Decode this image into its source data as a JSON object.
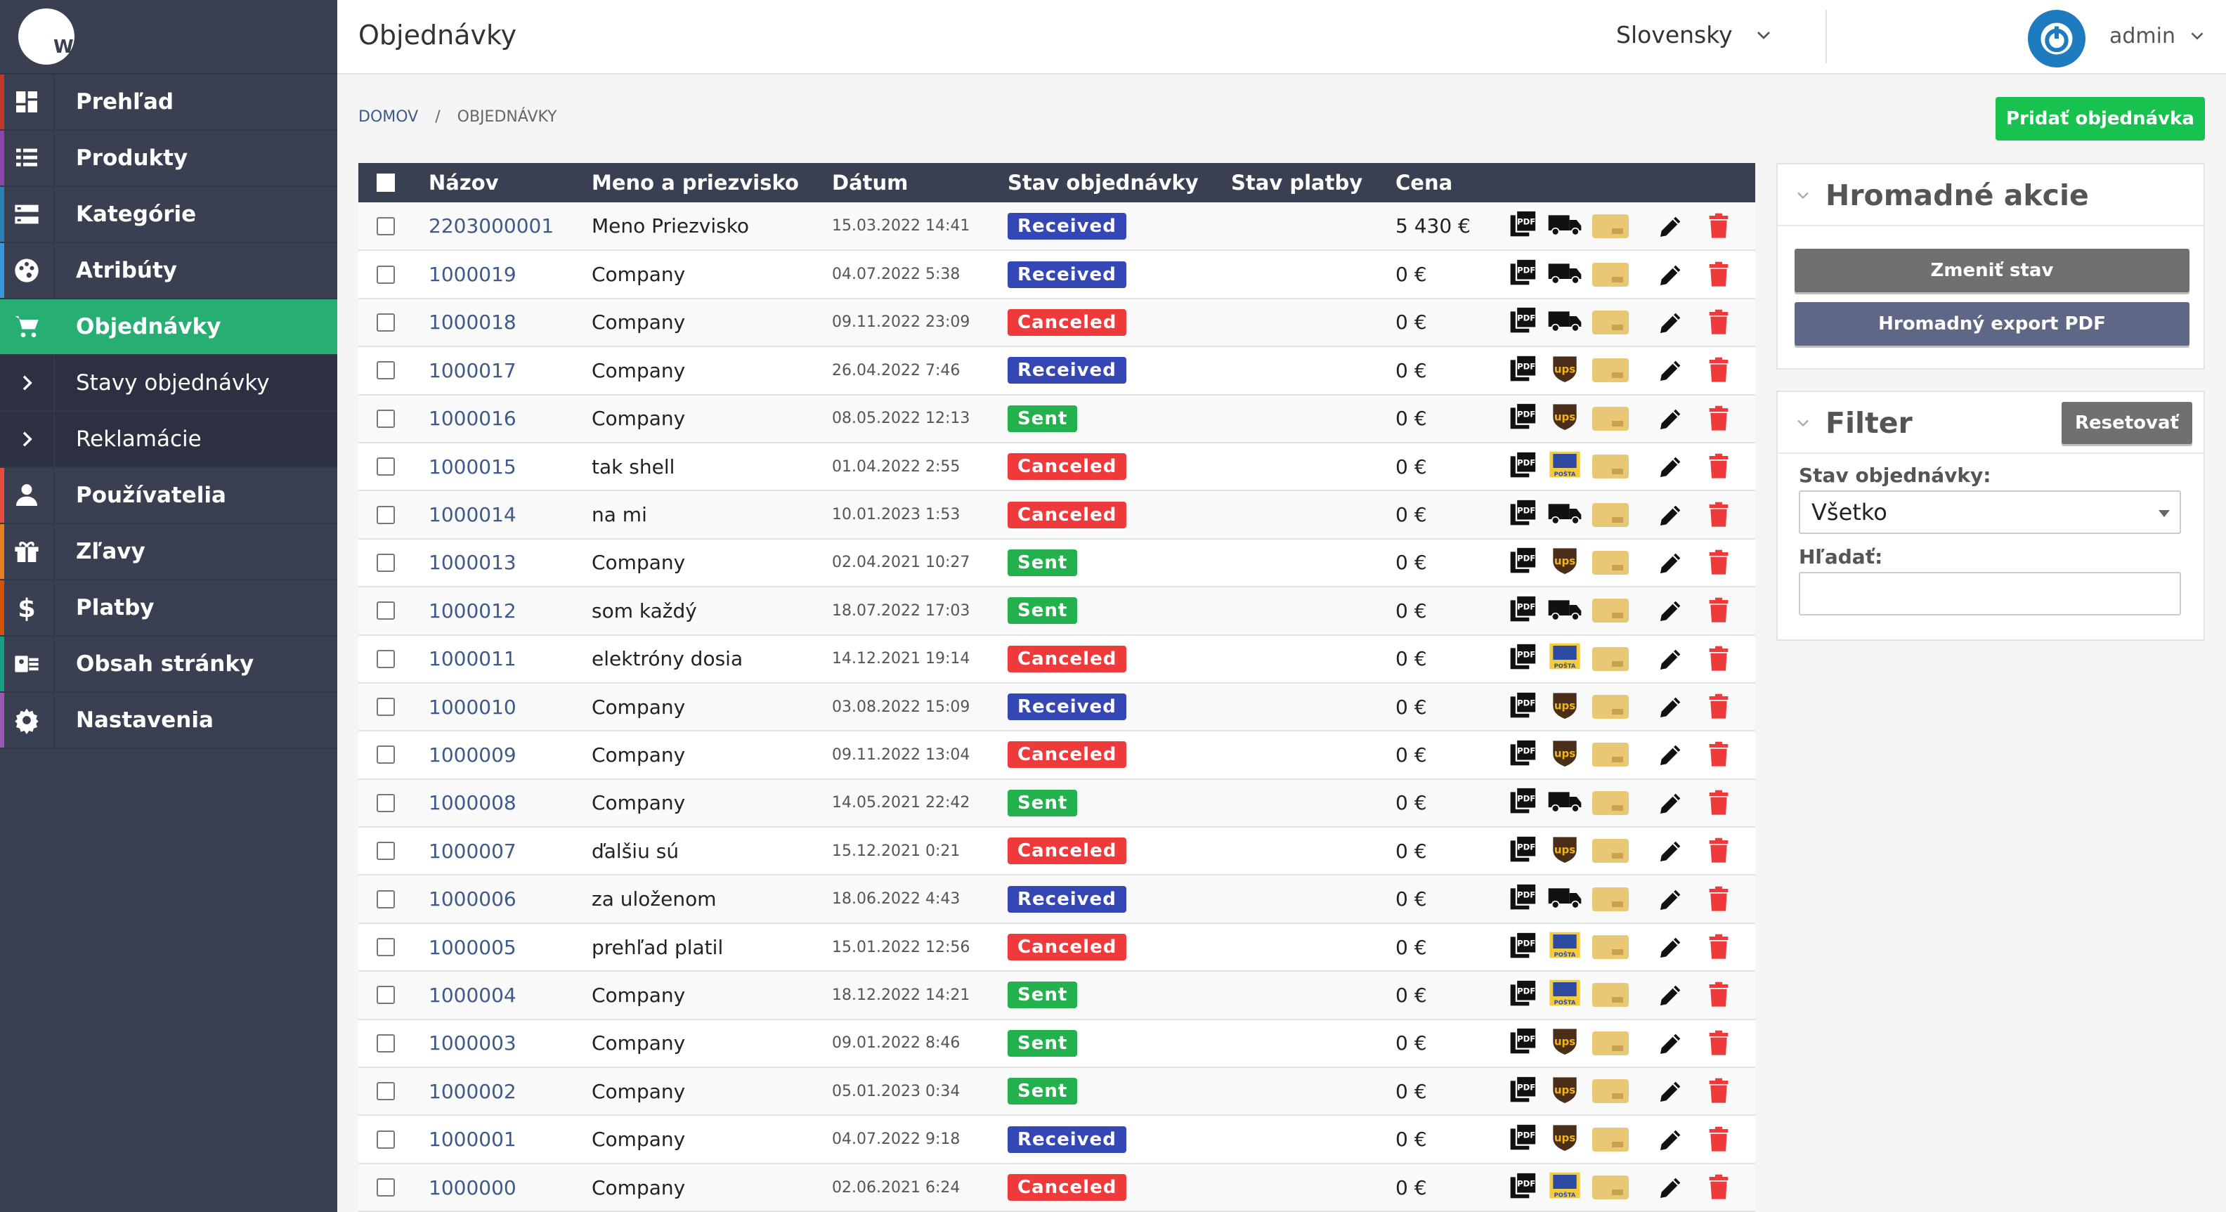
{
  "app": {
    "logo_text": "WISDOM",
    "page_title": "Objednávky"
  },
  "header": {
    "language": "Slovensky",
    "user": "admin"
  },
  "sidebar": {
    "items": [
      {
        "label": "Prehľad",
        "icon": "dashboard-icon",
        "stripe": "#c0392b"
      },
      {
        "label": "Produkty",
        "icon": "list-icon",
        "stripe": "#8e44ad"
      },
      {
        "label": "Kategórie",
        "icon": "storage-icon",
        "stripe": "#2980b9"
      },
      {
        "label": "Atribúty",
        "icon": "palette-icon",
        "stripe": "#3498db"
      },
      {
        "label": "Objednávky",
        "icon": "cart-icon",
        "stripe": "#27ae73",
        "active": true
      },
      {
        "label": "Stavy objednávky",
        "icon": "chevron-right-icon",
        "sub": true
      },
      {
        "label": "Reklamácie",
        "icon": "chevron-right-icon",
        "sub": true
      },
      {
        "label": "Používatelia",
        "icon": "person-icon",
        "stripe": "#e74c3c"
      },
      {
        "label": "Zľavy",
        "icon": "gift-icon",
        "stripe": "#e67e22"
      },
      {
        "label": "Platby",
        "icon": "dollar-icon",
        "stripe": "#d35400"
      },
      {
        "label": "Obsah stránky",
        "icon": "content-icon",
        "stripe": "#16a085"
      },
      {
        "label": "Nastavenia",
        "icon": "gear-icon",
        "stripe": "#9b59b6"
      }
    ]
  },
  "breadcrumb": {
    "home": "DOMOV",
    "sep": "/",
    "current": "OBJEDNÁVKY"
  },
  "toolbar": {
    "add_order": "Pridať objednávka"
  },
  "table": {
    "headers": {
      "name": "Názov",
      "person": "Meno a priezvisko",
      "date": "Dátum",
      "order_status": "Stav objednávky",
      "payment_status": "Stav platby",
      "price": "Cena"
    },
    "rows": [
      {
        "id": "2203000001",
        "name": "Meno Priezvisko",
        "date": "15.03.2022 14:41",
        "status": "Received",
        "price": "5 430 €",
        "ship": "truck"
      },
      {
        "id": "1000019",
        "name": "Company",
        "date": "04.07.2022 5:38",
        "status": "Received",
        "price": "0 €",
        "ship": "truck"
      },
      {
        "id": "1000018",
        "name": "Company",
        "date": "09.11.2022 23:09",
        "status": "Canceled",
        "price": "0 €",
        "ship": "truck"
      },
      {
        "id": "1000017",
        "name": "Company",
        "date": "26.04.2022 7:46",
        "status": "Received",
        "price": "0 €",
        "ship": "ups"
      },
      {
        "id": "1000016",
        "name": "Company",
        "date": "08.05.2022 12:13",
        "status": "Sent",
        "price": "0 €",
        "ship": "ups"
      },
      {
        "id": "1000015",
        "name": "tak shell",
        "date": "01.04.2022 2:55",
        "status": "Canceled",
        "price": "0 €",
        "ship": "posta"
      },
      {
        "id": "1000014",
        "name": "na mi",
        "date": "10.01.2023 1:53",
        "status": "Canceled",
        "price": "0 €",
        "ship": "truck"
      },
      {
        "id": "1000013",
        "name": "Company",
        "date": "02.04.2021 10:27",
        "status": "Sent",
        "price": "0 €",
        "ship": "ups"
      },
      {
        "id": "1000012",
        "name": "som každý",
        "date": "18.07.2022 17:03",
        "status": "Sent",
        "price": "0 €",
        "ship": "truck"
      },
      {
        "id": "1000011",
        "name": "elektróny dosia",
        "date": "14.12.2021 19:14",
        "status": "Canceled",
        "price": "0 €",
        "ship": "posta"
      },
      {
        "id": "1000010",
        "name": "Company",
        "date": "03.08.2022 15:09",
        "status": "Received",
        "price": "0 €",
        "ship": "ups"
      },
      {
        "id": "1000009",
        "name": "Company",
        "date": "09.11.2022 13:04",
        "status": "Canceled",
        "price": "0 €",
        "ship": "ups"
      },
      {
        "id": "1000008",
        "name": "Company",
        "date": "14.05.2021 22:42",
        "status": "Sent",
        "price": "0 €",
        "ship": "truck"
      },
      {
        "id": "1000007",
        "name": "ďalšiu sú",
        "date": "15.12.2021 0:21",
        "status": "Canceled",
        "price": "0 €",
        "ship": "ups"
      },
      {
        "id": "1000006",
        "name": "za uloženom",
        "date": "18.06.2022 4:43",
        "status": "Received",
        "price": "0 €",
        "ship": "truck"
      },
      {
        "id": "1000005",
        "name": "prehľad platil",
        "date": "15.01.2022 12:56",
        "status": "Canceled",
        "price": "0 €",
        "ship": "posta"
      },
      {
        "id": "1000004",
        "name": "Company",
        "date": "18.12.2022 14:21",
        "status": "Sent",
        "price": "0 €",
        "ship": "posta"
      },
      {
        "id": "1000003",
        "name": "Company",
        "date": "09.01.2022 8:46",
        "status": "Sent",
        "price": "0 €",
        "ship": "ups"
      },
      {
        "id": "1000002",
        "name": "Company",
        "date": "05.01.2023 0:34",
        "status": "Sent",
        "price": "0 €",
        "ship": "ups"
      },
      {
        "id": "1000001",
        "name": "Company",
        "date": "04.07.2022 9:18",
        "status": "Received",
        "price": "0 €",
        "ship": "ups"
      },
      {
        "id": "1000000",
        "name": "Company",
        "date": "02.06.2021 6:24",
        "status": "Canceled",
        "price": "0 €",
        "ship": "posta"
      }
    ]
  },
  "status_colors": {
    "Received": "#3547b5",
    "Canceled": "#ee3a3a",
    "Sent": "#22b14c"
  },
  "bulk": {
    "title": "Hromadné akcie",
    "change_status": "Zmeniť stav",
    "export_pdf": "Hromadný export PDF"
  },
  "filter": {
    "title": "Filter",
    "reset": "Resetovať",
    "status_label": "Stav objednávky:",
    "status_value": "Všetko",
    "search_label": "Hľadať:"
  },
  "icon_text": {
    "pdf": "PDF",
    "ups": "ups",
    "posta": "POŠTA"
  },
  "colors": {
    "sidebar_bg": "#3a3f51",
    "active_green": "#27ae73",
    "add_button": "#17c24e",
    "link_blue": "#3e5a8a",
    "delete_red": "#ee3a3a"
  }
}
